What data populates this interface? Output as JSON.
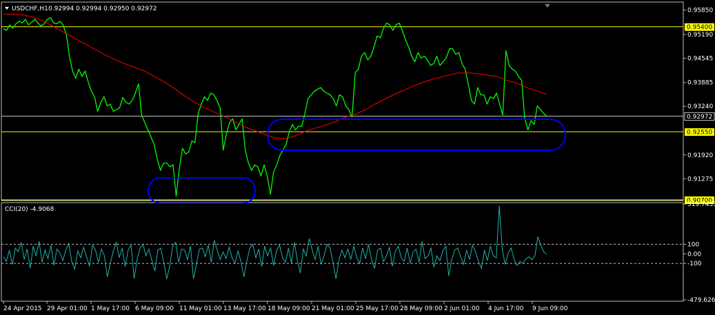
{
  "header": {
    "menu_icon": "triangle-down-icon",
    "symbol": "USDCHF,H1",
    "ohlc": "0.92994 0.92994 0.92950 0.92972"
  },
  "colors": {
    "background": "#000000",
    "frame": "#c0c0c0",
    "price": "#00ff00",
    "ma": "#ff0000",
    "hline": "#ffff00",
    "current_line": "#c0c0c0",
    "zone": "#0000ff",
    "cci": "#20b2aa",
    "cci_levels": "#c0c0c0"
  },
  "chart_data": [
    {
      "type": "line",
      "title": "USDCHF,H1",
      "ylim": [
        0.907,
        0.9605
      ],
      "y_ticks": [
        "0.95850",
        "0.95190",
        "0.94545",
        "0.93885",
        "0.93240",
        "0.91920",
        "0.91275"
      ],
      "horizontal_levels": [
        {
          "value": 0.954,
          "label": "0.95400",
          "color": "#ffff00"
        },
        {
          "value": 0.9255,
          "label": "0.92550",
          "color": "#ffff00"
        },
        {
          "value": 0.907,
          "label": "0.90700",
          "color": "#ffff00"
        }
      ],
      "current_price": {
        "value": 0.92972,
        "label": "0.92972"
      },
      "series": [
        {
          "line": "price",
          "values": [
            0.9535,
            0.953,
            0.9545,
            0.9536,
            0.9548,
            0.9555,
            0.955,
            0.956,
            0.9545,
            0.9552,
            0.956,
            0.955,
            0.9542,
            0.9548,
            0.956,
            0.9565,
            0.955,
            0.9548,
            0.9555,
            0.9545,
            0.952,
            0.946,
            0.942,
            0.94,
            0.9425,
            0.9405,
            0.942,
            0.939,
            0.9365,
            0.935,
            0.931,
            0.9335,
            0.935,
            0.9325,
            0.933,
            0.931,
            0.9315,
            0.932,
            0.9348,
            0.9335,
            0.933,
            0.934,
            0.936,
            0.9385,
            0.93,
            0.928,
            0.926,
            0.924,
            0.922,
            0.918,
            0.915,
            0.917,
            0.917,
            0.916,
            0.9165,
            0.908,
            0.9155,
            0.921,
            0.9195,
            0.92,
            0.923,
            0.9225,
            0.9305,
            0.933,
            0.935,
            0.934,
            0.936,
            0.9355,
            0.934,
            0.932,
            0.9205,
            0.925,
            0.928,
            0.929,
            0.926,
            0.9275,
            0.929,
            0.9205,
            0.917,
            0.915,
            0.9165,
            0.916,
            0.9135,
            0.9165,
            0.9135,
            0.9085,
            0.9145,
            0.9165,
            0.919,
            0.9205,
            0.922,
            0.9255,
            0.9275,
            0.926,
            0.927,
            0.927,
            0.9305,
            0.9345,
            0.9355,
            0.9365,
            0.937,
            0.9375,
            0.9365,
            0.936,
            0.9355,
            0.9345,
            0.9325,
            0.9355,
            0.935,
            0.9325,
            0.9315,
            0.9295,
            0.9415,
            0.9425,
            0.946,
            0.947,
            0.945,
            0.946,
            0.9485,
            0.9515,
            0.951,
            0.9535,
            0.955,
            0.9545,
            0.953,
            0.9545,
            0.955,
            0.953,
            0.9505,
            0.9485,
            0.946,
            0.9445,
            0.947,
            0.9455,
            0.946,
            0.945,
            0.9435,
            0.944,
            0.946,
            0.9435,
            0.9445,
            0.9455,
            0.948,
            0.948,
            0.9465,
            0.947,
            0.944,
            0.9425,
            0.9385,
            0.934,
            0.933,
            0.9375,
            0.9355,
            0.9355,
            0.933,
            0.935,
            0.9345,
            0.936,
            0.933,
            0.93,
            0.9475,
            0.9435,
            0.9425,
            0.942,
            0.9405,
            0.9395,
            0.929,
            0.926,
            0.9285,
            0.9275,
            0.9325,
            0.9315,
            0.9305,
            0.9297
          ]
        },
        {
          "line": "ma",
          "values": [
            0.9575,
            0.9574,
            0.9572,
            0.9565,
            0.9555,
            0.954,
            0.9525,
            0.951,
            0.9495,
            0.948,
            0.9465,
            0.9452,
            0.944,
            0.943,
            0.942,
            0.9405,
            0.939,
            0.9372,
            0.9352,
            0.9335,
            0.932,
            0.9308,
            0.9296,
            0.9282,
            0.9268,
            0.9258,
            0.9247,
            0.9238,
            0.9236,
            0.9244,
            0.9256,
            0.9265,
            0.9273,
            0.9282,
            0.9295,
            0.9303,
            0.9315,
            0.9331,
            0.9345,
            0.9358,
            0.937,
            0.9382,
            0.9392,
            0.94,
            0.9407,
            0.9414,
            0.9415,
            0.9413,
            0.9409,
            0.9405,
            0.9395,
            0.9387,
            0.9375,
            0.9366,
            0.9357
          ]
        }
      ]
    },
    {
      "type": "line",
      "title": "CCI(20) -4.9068",
      "ylim": [
        -479.6265,
        519.7431
      ],
      "y_ticks": [
        "519.7431",
        "100",
        "0.00",
        "-100",
        "-479.6265"
      ],
      "levels": [
        100,
        -100
      ],
      "series": [
        {
          "line": "cci",
          "values": [
            -30,
            -80,
            40,
            -110,
            60,
            20,
            120,
            -60,
            50,
            -150,
            80,
            -20,
            130,
            -90,
            40,
            -50,
            90,
            -120,
            50,
            10,
            -70,
            40,
            110,
            -80,
            -160,
            30,
            -40,
            70,
            -30,
            -130,
            90,
            40,
            -90,
            50,
            -20,
            -240,
            -100,
            30,
            120,
            -40,
            60,
            -130,
            40,
            90,
            -260,
            -60,
            60,
            100,
            -20,
            50,
            -70,
            -180,
            40,
            60,
            -90,
            -260,
            -130,
            80,
            120,
            -90,
            50,
            40,
            -60,
            80,
            -260,
            -110,
            50,
            60,
            -30,
            90,
            -90,
            140,
            40,
            -60,
            20,
            -50,
            70,
            -40,
            -100,
            30,
            -80,
            -240,
            -70,
            60,
            100,
            -40,
            50,
            -130,
            80,
            -20,
            60,
            -120,
            40,
            90,
            -40,
            -90,
            60,
            -100,
            120,
            -70,
            -200,
            50,
            -20,
            160,
            40,
            -60,
            80,
            -110,
            -20,
            100,
            60,
            -90,
            -260,
            -60,
            40,
            -40,
            50,
            -60,
            80,
            -40,
            -100,
            60,
            -50,
            100,
            -60,
            -150,
            40,
            60,
            -80,
            -20,
            70,
            -130,
            30,
            80,
            -40,
            -80,
            60,
            -100,
            20,
            50,
            -90,
            130,
            -50,
            -20,
            60,
            -140,
            -20,
            -70,
            30,
            80,
            -230,
            -60,
            40,
            60,
            -30,
            -110,
            40,
            -60,
            90,
            20,
            -80,
            -150,
            40,
            -70,
            80,
            -20,
            -40,
            500,
            50,
            -110,
            10,
            60,
            -60,
            -120,
            -80,
            -100,
            -50,
            -30,
            -60,
            -20,
            180,
            90,
            20,
            -5
          ]
        }
      ]
    }
  ],
  "x_axis": {
    "ticks": [
      "24 Apr 2015",
      "29 Apr 01:00",
      "1 May 17:00",
      "6 May 09:00",
      "11 May 01:00",
      "13 May 17:00",
      "18 May 09:00",
      "21 May 01:00",
      "25 May 17:00",
      "28 May 09:00",
      "2 Jun 01:00",
      "4 Jun 17:00",
      "9 Jun 09:00"
    ]
  },
  "annotations": [
    {
      "type": "zone-ellipse",
      "label": "support-zone-low"
    },
    {
      "type": "zone-ellipse",
      "label": "support-zone-high"
    }
  ]
}
